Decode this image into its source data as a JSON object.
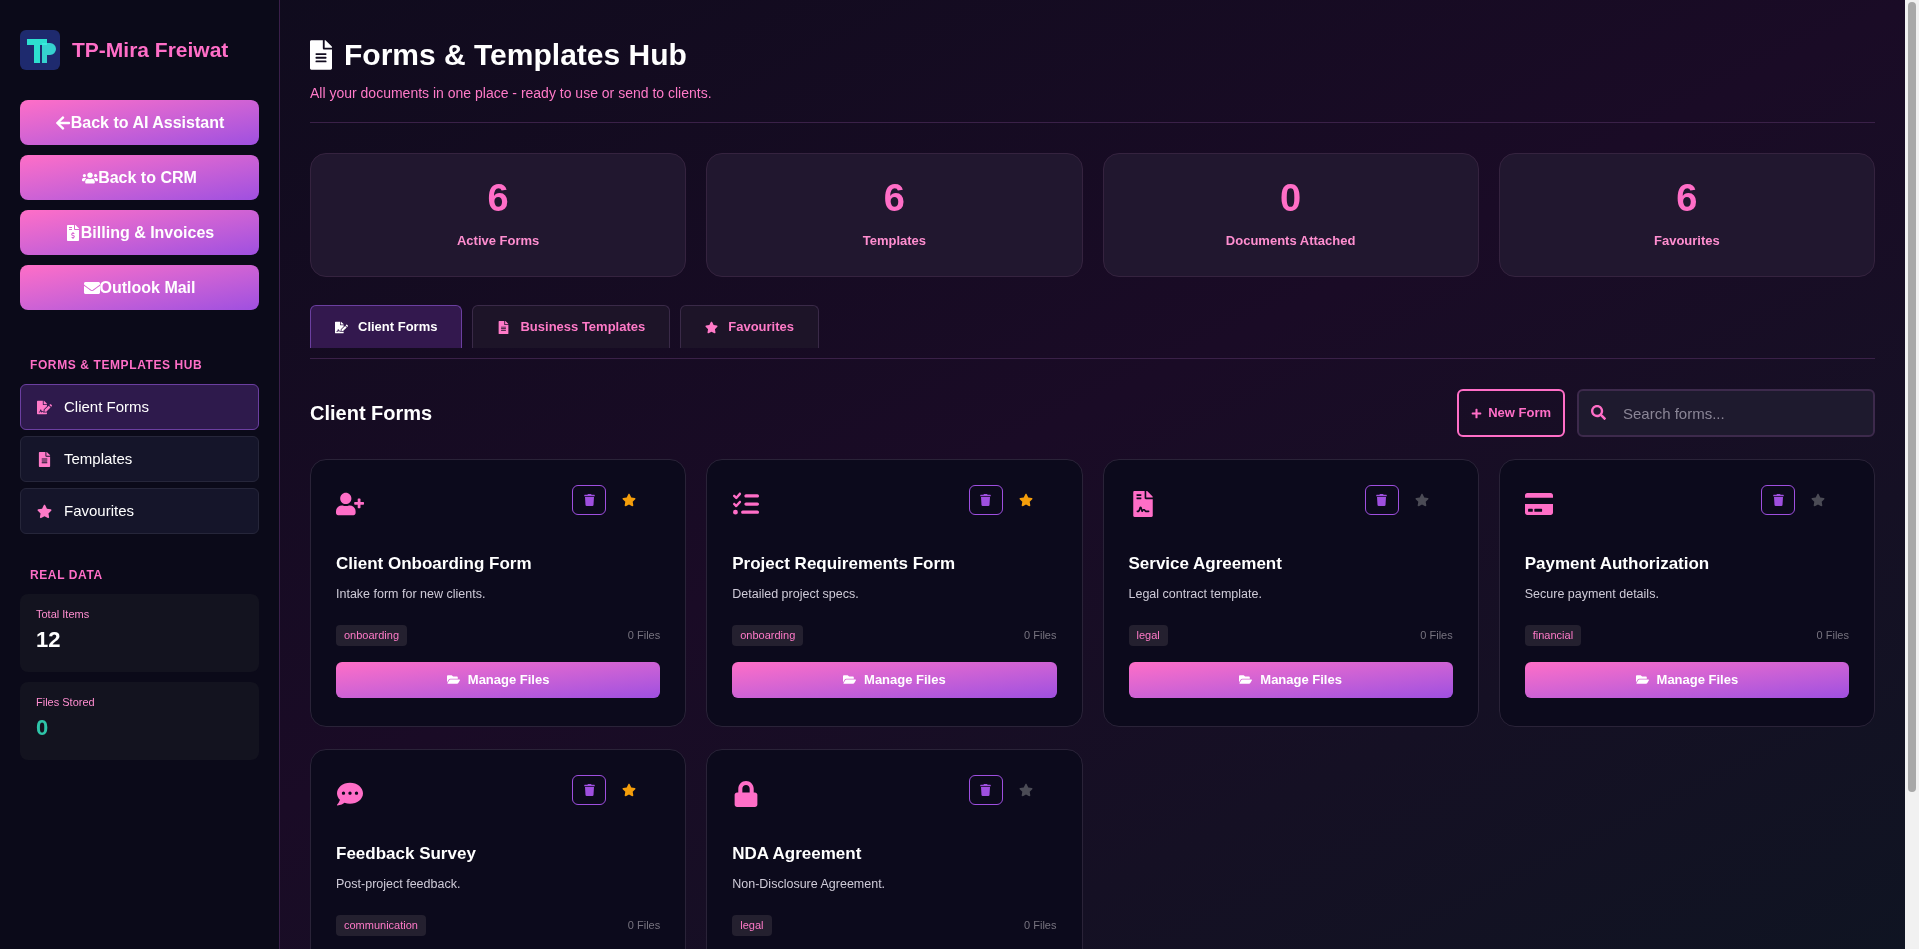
{
  "sidebar": {
    "brand": "TP-Mira Freiwat",
    "action_buttons": [
      {
        "label": "Back to AI Assistant"
      },
      {
        "label": "Back to CRM"
      },
      {
        "label": "Billing & Invoices"
      },
      {
        "label": "Outlook Mail"
      }
    ],
    "section_title": "FORMS & TEMPLATES HUB",
    "nav": [
      {
        "label": "Client Forms",
        "selected": true
      },
      {
        "label": "Templates",
        "selected": false
      },
      {
        "label": "Favourites",
        "selected": false
      }
    ],
    "data_title": "REAL DATA",
    "data_cards": [
      {
        "label": "Total Items",
        "value": "12",
        "kind": "count"
      },
      {
        "label": "Files Stored",
        "value": "0",
        "kind": "files"
      }
    ]
  },
  "header": {
    "title": "Forms & Templates Hub",
    "subtitle": "All your documents in one place - ready to use or send to clients."
  },
  "stats": [
    {
      "value": "6",
      "label": "Active Forms"
    },
    {
      "value": "6",
      "label": "Templates"
    },
    {
      "value": "0",
      "label": "Documents Attached"
    },
    {
      "value": "6",
      "label": "Favourites"
    }
  ],
  "tabs": [
    {
      "label": "Client Forms",
      "selected": true
    },
    {
      "label": "Business Templates",
      "selected": false
    },
    {
      "label": "Favourites",
      "selected": false
    }
  ],
  "section": {
    "title": "Client Forms",
    "new_button": "New Form",
    "search": {
      "placeholder": "Search forms..."
    }
  },
  "cards": [
    {
      "title": "Client Onboarding Form",
      "description": "Intake form for new clients.",
      "tag": "onboarding",
      "files": "0 Files",
      "favourite": true,
      "button": "Manage Files"
    },
    {
      "title": "Project Requirements Form",
      "description": "Detailed project specs.",
      "tag": "onboarding",
      "files": "0 Files",
      "favourite": true,
      "button": "Manage Files"
    },
    {
      "title": "Service Agreement",
      "description": "Legal contract template.",
      "tag": "legal",
      "files": "0 Files",
      "favourite": false,
      "button": "Manage Files"
    },
    {
      "title": "Payment Authorization",
      "description": "Secure payment details.",
      "tag": "financial",
      "files": "0 Files",
      "favourite": false,
      "button": "Manage Files"
    },
    {
      "title": "Feedback Survey",
      "description": "Post-project feedback.",
      "tag": "communication",
      "files": "0 Files",
      "favourite": true
    },
    {
      "title": "NDA Agreement",
      "description": "Non-Disclosure Agreement.",
      "tag": "legal",
      "files": "0 Files",
      "favourite": false
    }
  ]
}
